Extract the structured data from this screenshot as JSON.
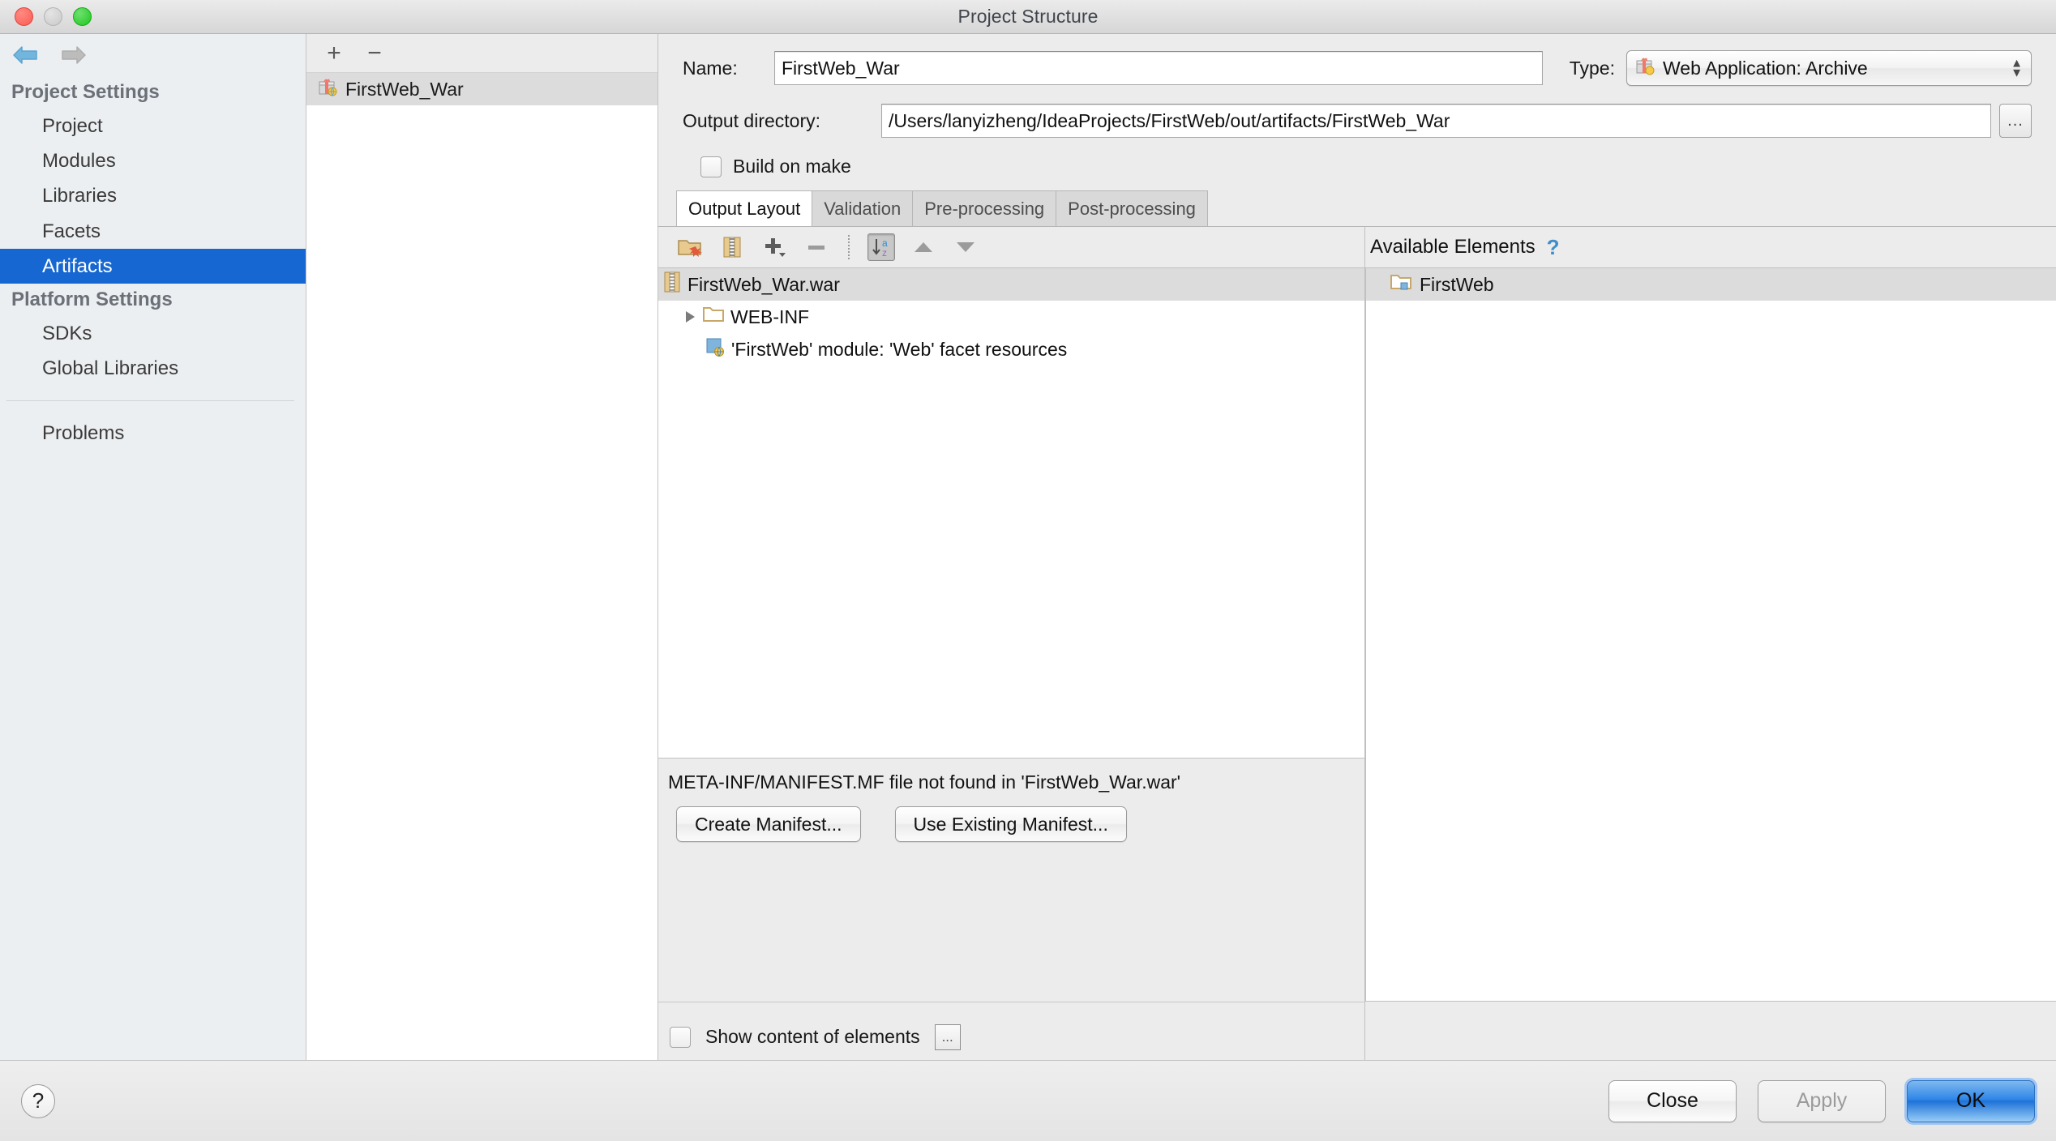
{
  "window": {
    "title": "Project Structure"
  },
  "sidebar": {
    "nav": {
      "back": "back-arrow",
      "forward": "forward-arrow"
    },
    "groups": [
      {
        "label": "Project Settings",
        "items": [
          {
            "label": "Project",
            "selected": false
          },
          {
            "label": "Modules",
            "selected": false
          },
          {
            "label": "Libraries",
            "selected": false
          },
          {
            "label": "Facets",
            "selected": false
          },
          {
            "label": "Artifacts",
            "selected": true
          }
        ]
      },
      {
        "label": "Platform Settings",
        "items": [
          {
            "label": "SDKs",
            "selected": false
          },
          {
            "label": "Global Libraries",
            "selected": false
          }
        ]
      }
    ],
    "problems": "Problems",
    "selected_color": "#1667d1"
  },
  "artifacts_panel": {
    "toolbar": {
      "add": "+",
      "remove": "−"
    },
    "items": [
      {
        "label": "FirstWeb_War",
        "icon": "artifact-war-icon",
        "selected": true
      }
    ]
  },
  "details": {
    "name_label": "Name:",
    "name_value": "FirstWeb_War",
    "type_label": "Type:",
    "type_value": "Web Application: Archive",
    "output_dir_label": "Output directory:",
    "output_dir_value": "/Users/lanyizheng/IdeaProjects/FirstWeb/out/artifacts/FirstWeb_War",
    "browse_label": "...",
    "build_on_make_label": "Build on make",
    "build_on_make_checked": false
  },
  "tabs": [
    {
      "label": "Output Layout",
      "active": true
    },
    {
      "label": "Validation",
      "active": false
    },
    {
      "label": "Pre-processing",
      "active": false
    },
    {
      "label": "Post-processing",
      "active": false
    }
  ],
  "output_layout": {
    "toolbar_icons": [
      "new-folder-icon",
      "new-archive-icon",
      "add-icon",
      "remove-icon",
      "sort-alphabetically-icon",
      "move-up-icon",
      "move-down-icon"
    ],
    "sort_toggled": true,
    "tree": [
      {
        "label": "FirstWeb_War.war",
        "icon": "archive-icon",
        "indent": 0,
        "selected": true,
        "expandable": false
      },
      {
        "label": "WEB-INF",
        "icon": "folder-icon",
        "indent": 1,
        "selected": false,
        "expandable": true
      },
      {
        "label": "'FirstWeb' module: 'Web' facet resources",
        "icon": "web-facet-icon",
        "indent": 2,
        "selected": false,
        "expandable": false
      }
    ],
    "manifest_message": "META-INF/MANIFEST.MF file not found in 'FirstWeb_War.war'",
    "create_manifest_label": "Create Manifest...",
    "use_existing_manifest_label": "Use Existing Manifest...",
    "show_content_label": "Show content of elements",
    "show_content_checked": false,
    "show_content_ellipsis": "..."
  },
  "available_elements": {
    "title": "Available Elements",
    "help_glyph": "?",
    "items": [
      {
        "label": "FirstWeb",
        "icon": "module-folder-icon",
        "selected": true
      }
    ]
  },
  "bottom_bar": {
    "help_glyph": "?",
    "buttons": [
      {
        "label": "Close",
        "state": "enabled"
      },
      {
        "label": "Apply",
        "state": "disabled"
      },
      {
        "label": "OK",
        "state": "default"
      }
    ]
  }
}
